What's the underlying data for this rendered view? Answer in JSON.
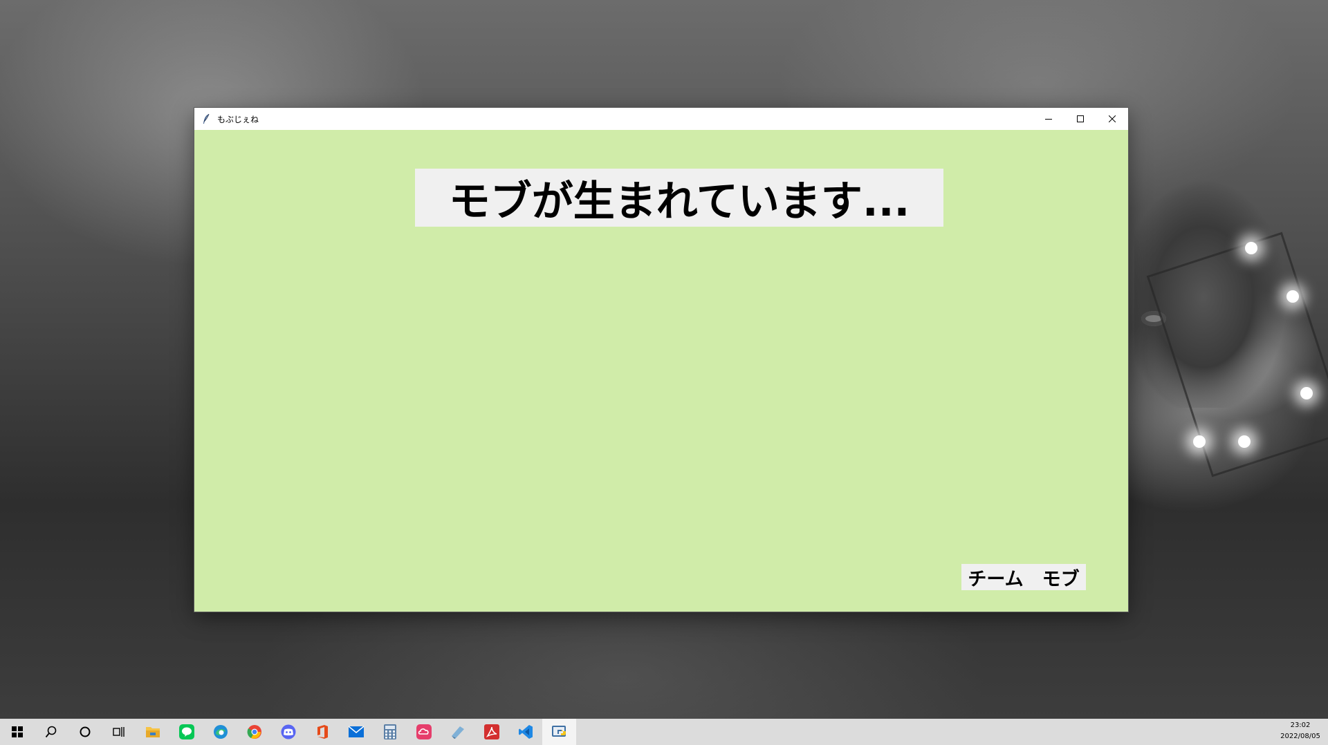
{
  "window": {
    "title": "もぶじぇね",
    "background_color": "#d0eca9",
    "heading": "モブが生まれています...",
    "credit": "チーム　モブ",
    "controls": {
      "minimize_icon": "minimize-icon",
      "maximize_icon": "maximize-icon",
      "close_icon": "close-icon"
    }
  },
  "taskbar": {
    "items": [
      {
        "name": "start-button",
        "icon": "windows-logo-icon"
      },
      {
        "name": "search-button",
        "icon": "search-icon"
      },
      {
        "name": "cortana-button",
        "icon": "circle-icon"
      },
      {
        "name": "task-view-button",
        "icon": "task-view-icon"
      },
      {
        "name": "file-explorer",
        "icon": "folder-icon",
        "color": "#f6c344"
      },
      {
        "name": "line",
        "icon": "line-chat-icon",
        "color": "#06c755"
      },
      {
        "name": "edge",
        "icon": "edge-browser-icon",
        "color": "#1f8fd6"
      },
      {
        "name": "chrome",
        "icon": "chrome-browser-icon",
        "color": "#ea4335"
      },
      {
        "name": "discord",
        "icon": "discord-icon",
        "color": "#5865f2"
      },
      {
        "name": "office",
        "icon": "office-icon",
        "color": "#e64a19"
      },
      {
        "name": "mail",
        "icon": "mail-icon",
        "color": "#0a6fd8"
      },
      {
        "name": "calculator",
        "icon": "calculator-icon",
        "color": "#5b7fa6"
      },
      {
        "name": "creative-cloud",
        "icon": "creative-cloud-icon",
        "color": "#e63d6b"
      },
      {
        "name": "notes-app",
        "icon": "notes-icon",
        "color": "#7fb0d6"
      },
      {
        "name": "acrobat",
        "icon": "acrobat-icon",
        "color": "#d32f2f"
      },
      {
        "name": "vscode",
        "icon": "vscode-icon",
        "color": "#1e88e5"
      },
      {
        "name": "python-app",
        "icon": "python-icon",
        "color": "#3d6fa3",
        "active": true
      }
    ],
    "clock": {
      "time": "23:02",
      "date": "2022/08/05"
    }
  }
}
